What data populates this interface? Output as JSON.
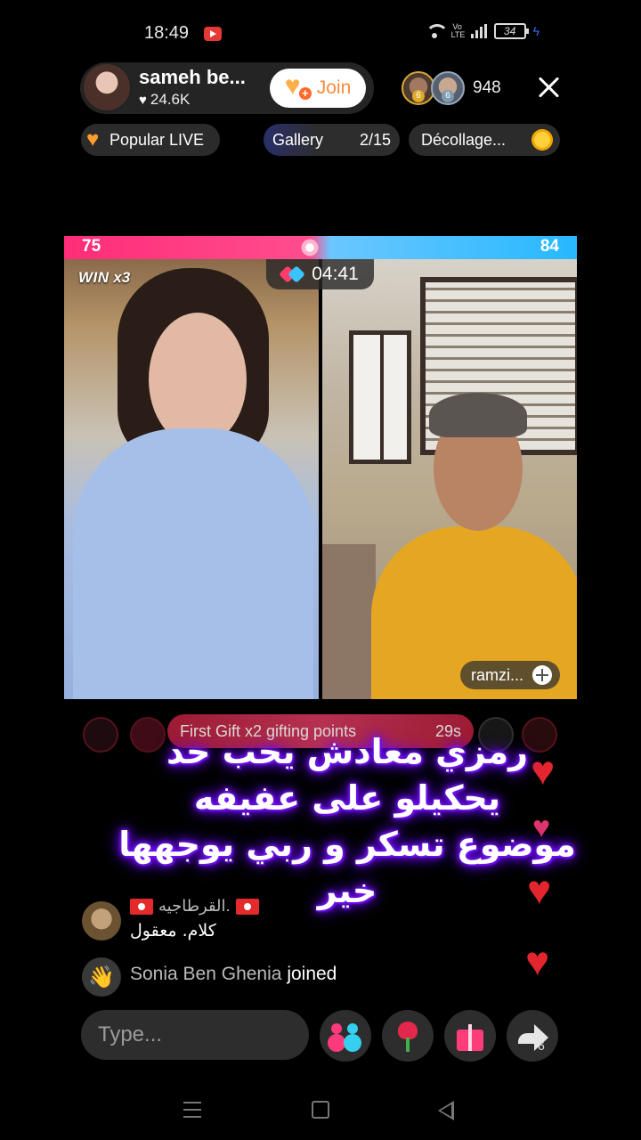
{
  "status_bar": {
    "time": "18:49",
    "battery": "34",
    "volte": "Vo LTE"
  },
  "header": {
    "host_name": "sameh be...",
    "host_likes": "24.6K",
    "join_label": "Join",
    "viewer_ranks": [
      "6",
      "6"
    ],
    "viewer_count": "948"
  },
  "chips": {
    "popular": "Popular LIVE",
    "gallery": "Gallery",
    "gallery_count": "2/15",
    "decollage": "Décollage..."
  },
  "battle": {
    "score_left": "75",
    "score_right": "84",
    "win_label": "WIN",
    "win_multiplier": "x3",
    "timer": "04:41",
    "guest_name": "ramzi..."
  },
  "gift_banner": {
    "text": "First Gift x2 gifting points",
    "timer": "29s"
  },
  "caption": {
    "lines": [
      "رمزي معادش يحب حد",
      "يحكيلو على عفيفه",
      "موضوع تسكر و ربي يوجهها خير"
    ]
  },
  "comments": [
    {
      "user": "القرطاجيه.",
      "text": "كلام. معقول"
    }
  ],
  "joined": {
    "who": "Sonia Ben Ghenia",
    "action": "joined"
  },
  "bottom_bar": {
    "input_placeholder": "Type...",
    "share_count": "6"
  },
  "colors": {
    "team_left": "#ff2d77",
    "team_right": "#27b8ff",
    "join_accent": "#ff8a3a",
    "heart": "#e3262e"
  }
}
